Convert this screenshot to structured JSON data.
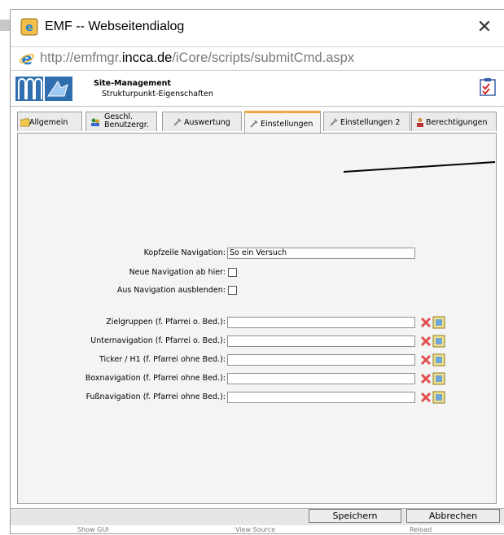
{
  "window": {
    "title": "EMF -- Webseitendialog",
    "close_glyph": "✕"
  },
  "address": {
    "prefix": "http://emfmgr.",
    "domain": "incca.de",
    "path": "/iCore/scripts/submitCmd.aspx"
  },
  "header": {
    "title": "Site-Management",
    "subtitle": "Strukturpunkt-Eigenschaften"
  },
  "tabs": [
    {
      "label": "Allgemein",
      "icon": "folder-icon"
    },
    {
      "label_line1": "Geschl.",
      "label_line2": "Benutzergr.",
      "icon": "users-icon"
    },
    {
      "label": "Auswertung",
      "icon": "tools-icon"
    },
    {
      "label": "Einstellungen",
      "icon": "tools-icon",
      "active": true
    },
    {
      "label": "Einstellungen 2",
      "icon": "tools-icon"
    },
    {
      "label": "Berechtigungen",
      "icon": "user-icon"
    }
  ],
  "form": {
    "kopfzeile_label": "Kopfzeile Navigation:",
    "kopfzeile_value": "So ein Versuch",
    "neue_nav_label": "Neue Navigation ab hier:",
    "neue_nav_checked": false,
    "aus_nav_label": "Aus Navigation ausblenden:",
    "aus_nav_checked": false,
    "fields": [
      {
        "label": "Zielgruppen (f. Pfarrei o. Bed.):",
        "value": ""
      },
      {
        "label": "Unternavigation (f. Pfarrei o. Bed.):",
        "value": ""
      },
      {
        "label": "Ticker / H1 (f. Pfarrei ohne Bed.):",
        "value": ""
      },
      {
        "label": "Boxnavigation (f. Pfarrei ohne Bed.):",
        "value": ""
      },
      {
        "label": "Fußnavigation (f. Pfarrei ohne Bed.):",
        "value": ""
      }
    ]
  },
  "footer": {
    "save_label": "Speichern",
    "cancel_label": "Abbrechen"
  },
  "statusbar": {
    "left": "Show GUI",
    "middle": "View Source",
    "right": "Reload"
  },
  "colors": {
    "active_tab_accent": "#f2a63c",
    "ie_blue": "#1e7fd6",
    "delete_red": "#e05050"
  }
}
